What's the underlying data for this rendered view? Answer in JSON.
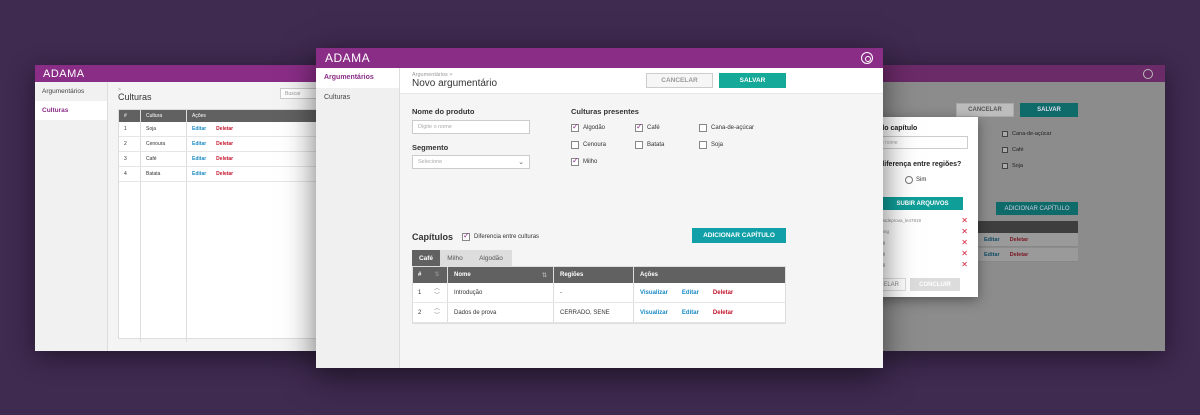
{
  "colors": {
    "background": "#3f2a50",
    "brand": "#8a2d86",
    "accent": "#15a99a",
    "link": "#1b8ac4",
    "danger": "#c4162c"
  },
  "left_window": {
    "brand": "ADAMA",
    "sidebar": [
      {
        "label": "Argumentários"
      },
      {
        "label": "Culturas"
      }
    ],
    "breadcrumb": ">",
    "title": "Culturas",
    "search_placeholder": "Buscar",
    "table": {
      "headers": [
        "#",
        "Cultura",
        "Ações"
      ],
      "rows": [
        {
          "n": "1",
          "name": "Soja",
          "edit": "Editar",
          "delete": "Deletar"
        },
        {
          "n": "2",
          "name": "Cenoura",
          "edit": "Editar",
          "delete": "Deletar"
        },
        {
          "n": "3",
          "name": "Café",
          "edit": "Editar",
          "delete": "Deletar"
        },
        {
          "n": "4",
          "name": "Batata",
          "edit": "Editar",
          "delete": "Deletar"
        }
      ]
    }
  },
  "main_window": {
    "brand": "ADAMA",
    "icon": "gear-icon",
    "sidebar": [
      {
        "label": "Argumentários"
      },
      {
        "label": "Culturas"
      }
    ],
    "breadcrumb": "Argumentários  >",
    "title": "Novo argumentário",
    "cancel_label": "CANCELAR",
    "save_label": "SALVAR",
    "product_name_label": "Nome do produto",
    "product_name_placeholder": "Digite o nome",
    "segment_label": "Segmento",
    "segment_placeholder": "Selecione",
    "cultures_label": "Culturas presentes",
    "cultures": [
      {
        "label": "Algodão",
        "checked": true
      },
      {
        "label": "Café",
        "checked": true
      },
      {
        "label": "Cana-de-açúcar",
        "checked": false
      },
      {
        "label": "Cenoura",
        "checked": false
      },
      {
        "label": "Batata",
        "checked": false
      },
      {
        "label": "Soja",
        "checked": false
      },
      {
        "label": "Milho",
        "checked": true
      }
    ],
    "chapters_label": "Capítulos",
    "differ_label": "Diferencia entre culturas",
    "add_chapter_label": "ADICIONAR CAPÍTULO",
    "tabs": [
      {
        "label": "Café"
      },
      {
        "label": "Milho"
      },
      {
        "label": "Algodão"
      }
    ],
    "table": {
      "headers": [
        "#",
        "Nome",
        "Regiões",
        "Ações"
      ],
      "rows": [
        {
          "n": "1",
          "name": "Introdução",
          "regions": "-",
          "view": "Visualizar",
          "edit": "Editar",
          "delete": "Deletar"
        },
        {
          "n": "2",
          "name": "Dados de prova",
          "regions": "CERRADO, SENE",
          "view": "Visualizar",
          "edit": "Editar",
          "delete": "Deletar"
        }
      ]
    }
  },
  "right_window": {
    "cancel_label": "CANCELAR",
    "save_label": "SALVAR",
    "cultures": [
      {
        "label": "Cana-de-açúcar"
      },
      {
        "label": "Café"
      },
      {
        "label": "Soja"
      }
    ],
    "add_chapter_label": "ADICIONAR CAPÍTULO",
    "rows": [
      {
        "edit": "Editar",
        "delete": "Deletar"
      },
      {
        "edit": "Editar",
        "delete": "Deletar"
      }
    ],
    "modal": {
      "chapter_name_label": "do capítulo",
      "chapter_name_placeholder": "e nome",
      "differ_question": "diferença entre regiões?",
      "option_no": "o",
      "option_yes": "Sim",
      "upload_label": "SUBIR ARQUIVOS",
      "files": [
        "dadosdeprova_le47819",
        "ato.png",
        "o.png",
        "o.png",
        "o.png"
      ],
      "cancel_label": "CELAR",
      "done_label": "CONCLUIR"
    }
  }
}
